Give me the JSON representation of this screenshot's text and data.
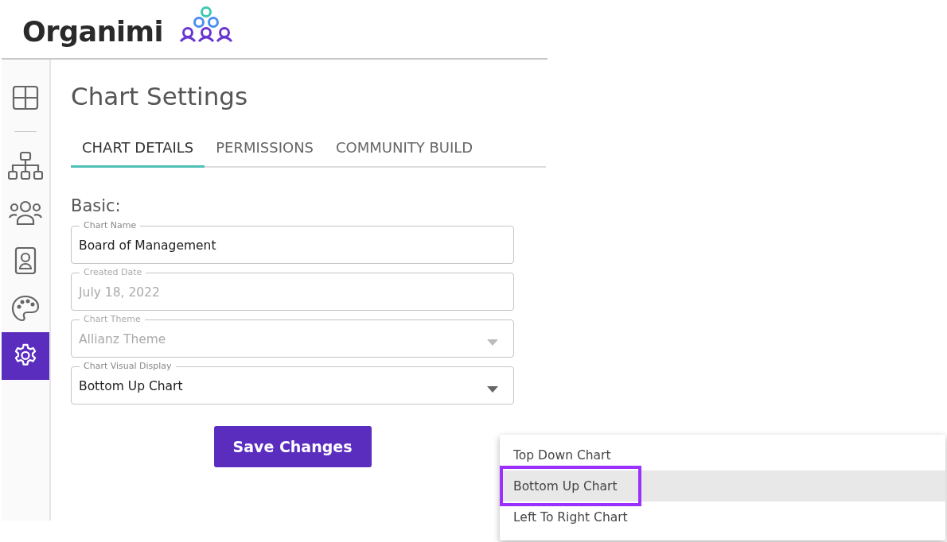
{
  "logo": {
    "text": "Organimi"
  },
  "sidebar": {
    "items": [
      {
        "selected": false
      },
      {
        "selected": false
      },
      {
        "selected": false
      },
      {
        "selected": false
      },
      {
        "selected": false
      },
      {
        "selected": true
      }
    ]
  },
  "page": {
    "title": "Chart Settings",
    "tabs": [
      {
        "label": "CHART DETAILS",
        "selected": true
      },
      {
        "label": "PERMISSIONS",
        "selected": false
      },
      {
        "label": "COMMUNITY BUILD",
        "selected": false
      }
    ],
    "section": "Basic:",
    "fields": [
      {
        "kind": "text",
        "label": "Chart Name",
        "value": "Board of Management",
        "disabled": false
      },
      {
        "kind": "text",
        "label": "Created Date",
        "value": "July 18, 2022",
        "disabled": true
      },
      {
        "kind": "select",
        "label": "Chart Theme",
        "value": "Allianz Theme",
        "disabled": true
      },
      {
        "kind": "select",
        "label": "Chart Visual Display",
        "value": "Bottom Up Chart",
        "disabled": false
      }
    ],
    "save_button": "Save Changes"
  },
  "dropdown_menu": {
    "items": [
      {
        "label": "Top Down Chart",
        "selected": false,
        "highlighted": false
      },
      {
        "label": "Bottom Up Chart",
        "selected": true,
        "highlighted": true
      },
      {
        "label": "Left To Right Chart",
        "selected": false,
        "highlighted": false
      }
    ]
  }
}
